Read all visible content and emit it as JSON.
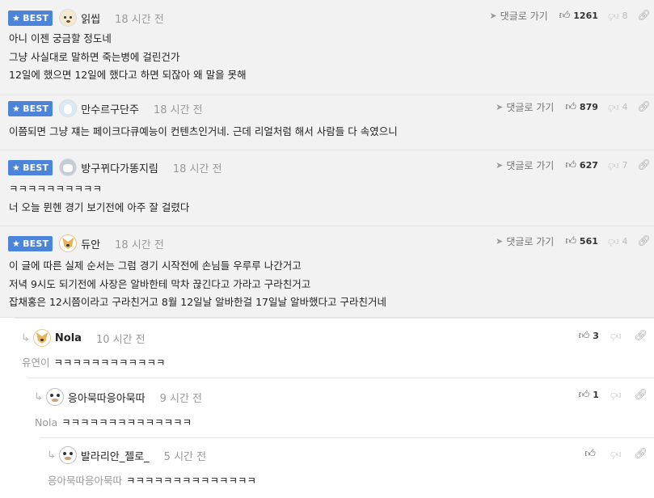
{
  "best_label": "BEST",
  "reply_link_label": "댓글로 가기",
  "best_comments": [
    {
      "username": "읽씹",
      "time": "18 시간 전",
      "avatar": "puppy-avatar",
      "likes": "1261",
      "dislikes": "8",
      "lines": [
        "아니 이젠 궁금할 정도네",
        "그냥 사실대로 말하면 죽는병에 걸린건가",
        "12일에 했으면 12일에 했다고 하면 되잖아 왜 말을 못해"
      ]
    },
    {
      "username": "만수르구단주",
      "time": "18 시간 전",
      "avatar": "white-cat-avatar",
      "likes": "879",
      "dislikes": "4",
      "lines": [
        "이쯤되면 그냥 쟤는 페이크다큐예능이 컨텐츠인거네. 근데 리얼처럼 해서 사람들 다 속였으니"
      ]
    },
    {
      "username": "방구뀌다가똥지림",
      "time": "18 시간 전",
      "avatar": "gray-dog-avatar",
      "likes": "627",
      "dislikes": "7",
      "lines": [
        "ㅋㅋㅋㅋㅋㅋㅋㅋㅋㅋ",
        "너 오늘 뮌헨 경기 보기전에 아주 잘 걸렸다"
      ]
    },
    {
      "username": "듀안",
      "time": "18 시간 전",
      "avatar": "fox-avatar",
      "likes": "561",
      "dislikes": "4",
      "lines": [
        "이 글에 따른 실제 순서는 그럼 경기 시작전에 손님들 우루루 나간거고",
        "저녁 9시도 되기전에 사장은 알바한테 막차 끊긴다고 가라고 구라친거고",
        "잡채홍은 12시쯤이라고 구라친거고 8월 12일날 알바한걸 17일날 알바했다고 구라친거네"
      ]
    }
  ],
  "replies": [
    {
      "username": "Nola",
      "time": "10 시간 전",
      "avatar": "fox-avatar",
      "likes": "3",
      "mention": "유연이",
      "text": "ㅋㅋㅋㅋㅋㅋㅋㅋㅋㅋㅋㅋ"
    },
    {
      "username": "응아묵따응아묵따",
      "time": "9 시간 전",
      "avatar": "panda-avatar",
      "likes": "1",
      "mention": "Nola",
      "text": "ㅋㅋㅋㅋㅋㅋㅋㅋㅋㅋㅋㅋㅋㅋ"
    },
    {
      "username": "발라리안_젤로_",
      "time": "5 시간 전",
      "avatar": "panda-avatar",
      "likes": "",
      "mention": "응아묵따응아묵따",
      "text": "ㅋㅋㅋㅋㅋㅋㅋㅋㅋㅋㅋㅋㅋㅋ"
    }
  ]
}
